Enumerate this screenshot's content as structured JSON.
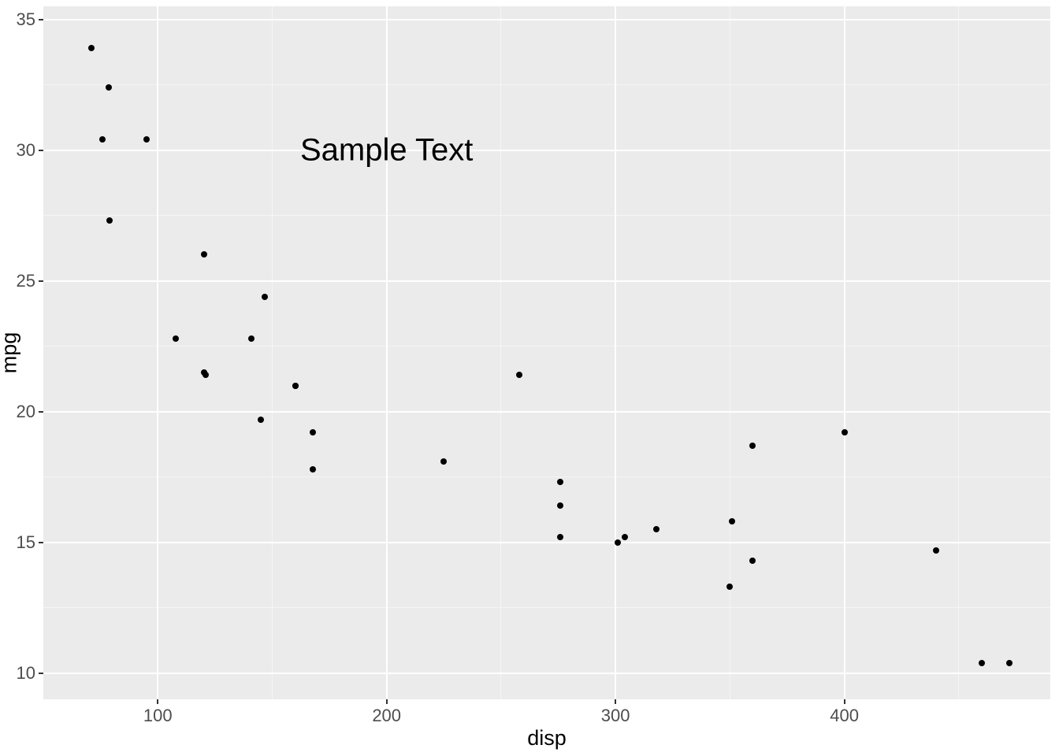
{
  "chart_data": {
    "type": "scatter",
    "xlabel": "disp",
    "ylabel": "mpg",
    "xlim": [
      50,
      490
    ],
    "ylim": [
      9,
      35.5
    ],
    "x_ticks": [
      100,
      200,
      300,
      400
    ],
    "y_ticks": [
      10,
      15,
      20,
      25,
      30,
      35
    ],
    "x_minor": [
      150,
      250,
      350,
      450
    ],
    "y_minor": [
      12.5,
      17.5,
      22.5,
      27.5,
      32.5
    ],
    "annotation": {
      "text": "Sample Text",
      "x": 200,
      "y": 30
    },
    "points": [
      {
        "x": 160.0,
        "y": 21.0
      },
      {
        "x": 160.0,
        "y": 21.0
      },
      {
        "x": 108.0,
        "y": 22.8
      },
      {
        "x": 258.0,
        "y": 21.4
      },
      {
        "x": 360.0,
        "y": 18.7
      },
      {
        "x": 225.0,
        "y": 18.1
      },
      {
        "x": 360.0,
        "y": 14.3
      },
      {
        "x": 146.7,
        "y": 24.4
      },
      {
        "x": 140.8,
        "y": 22.8
      },
      {
        "x": 167.6,
        "y": 19.2
      },
      {
        "x": 167.6,
        "y": 17.8
      },
      {
        "x": 275.8,
        "y": 16.4
      },
      {
        "x": 275.8,
        "y": 17.3
      },
      {
        "x": 275.8,
        "y": 15.2
      },
      {
        "x": 472.0,
        "y": 10.4
      },
      {
        "x": 460.0,
        "y": 10.4
      },
      {
        "x": 440.0,
        "y": 14.7
      },
      {
        "x": 78.7,
        "y": 32.4
      },
      {
        "x": 75.7,
        "y": 30.4
      },
      {
        "x": 71.1,
        "y": 33.9
      },
      {
        "x": 120.1,
        "y": 21.5
      },
      {
        "x": 318.0,
        "y": 15.5
      },
      {
        "x": 304.0,
        "y": 15.2
      },
      {
        "x": 350.0,
        "y": 13.3
      },
      {
        "x": 400.0,
        "y": 19.2
      },
      {
        "x": 79.0,
        "y": 27.3
      },
      {
        "x": 120.3,
        "y": 26.0
      },
      {
        "x": 95.1,
        "y": 30.4
      },
      {
        "x": 351.0,
        "y": 15.8
      },
      {
        "x": 145.0,
        "y": 19.7
      },
      {
        "x": 301.0,
        "y": 15.0
      },
      {
        "x": 121.0,
        "y": 21.4
      }
    ]
  }
}
